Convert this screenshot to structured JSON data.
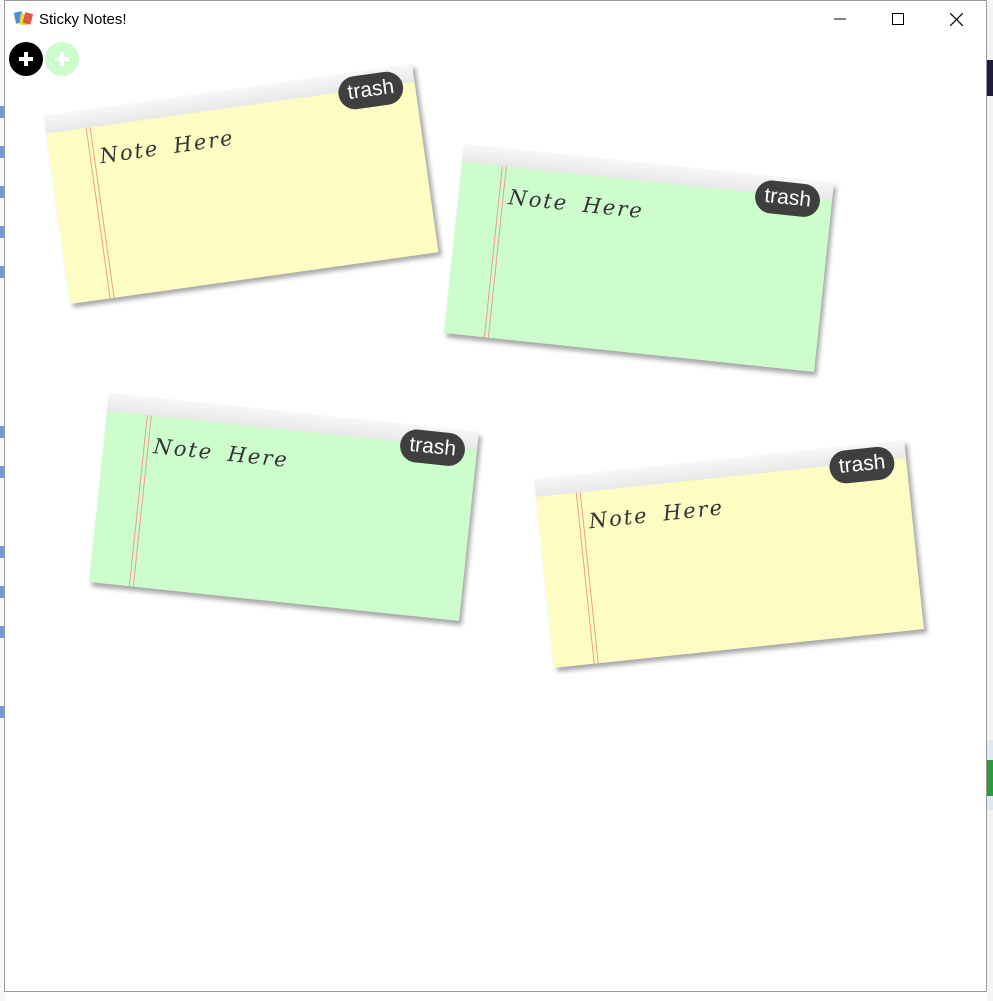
{
  "window": {
    "title": "Sticky Notes!",
    "icon": "sticky-notes-app-icon",
    "controls": [
      "minimize-icon",
      "maximize-icon",
      "close-icon"
    ]
  },
  "toolbar": {
    "add_buttons": [
      {
        "name": "add-note-black-button",
        "symbol": "+",
        "color": "#000000"
      },
      {
        "name": "add-note-green-button",
        "symbol": "+",
        "color": "#ccfccc"
      }
    ]
  },
  "notes": [
    {
      "text": "Note Here",
      "trash_label": "trash",
      "color": "#fdfdc3",
      "rotation_deg": -8
    },
    {
      "text": "Note Here",
      "trash_label": "trash",
      "color": "#cdfdcd",
      "rotation_deg": 6
    },
    {
      "text": "Note Here",
      "trash_label": "trash",
      "color": "#cdfdcd",
      "rotation_deg": 6
    },
    {
      "text": "Note Here",
      "trash_label": "trash",
      "color": "#fdfdc3",
      "rotation_deg": -6
    }
  ]
}
